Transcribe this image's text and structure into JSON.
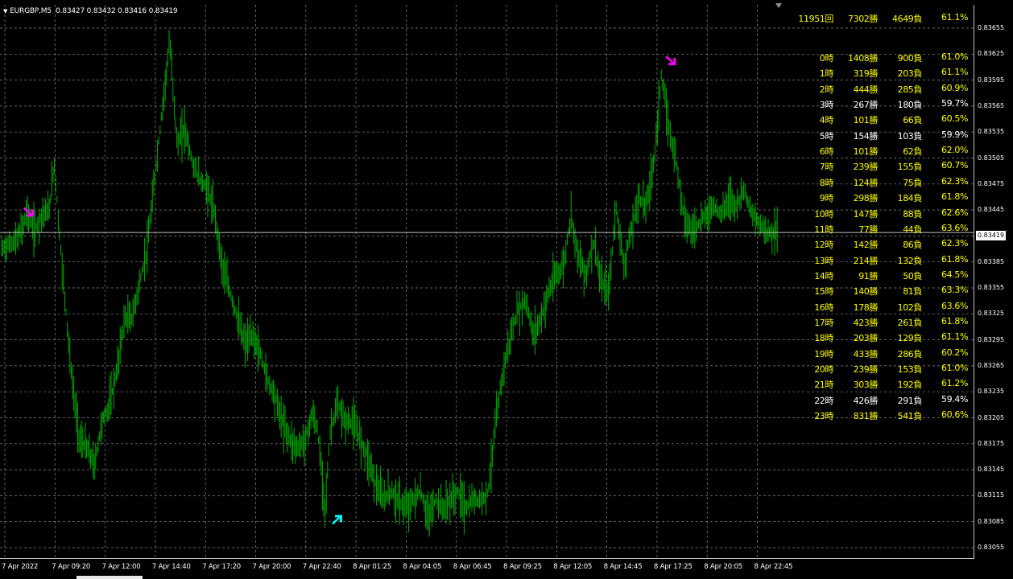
{
  "window": {
    "symbol": "EURGBP,M5",
    "ohlc": "0.83427 0.83432 0.83416 0.83419",
    "current_price": "0.83419"
  },
  "colors": {
    "background": "#000000",
    "candles": "#00b000",
    "grid": "#8a8a8a",
    "price_line": "#c0c0c0",
    "sell_arrow": "#ff00ff",
    "buy_arrow": "#00ffff",
    "stats_highlight": "#ffff00",
    "stats_normal": "#ffffff"
  },
  "y_axis": [
    "0.83655",
    "0.83625",
    "0.83595",
    "0.83565",
    "0.83535",
    "0.83505",
    "0.83475",
    "0.83445",
    "0.83415",
    "0.83385",
    "0.83355",
    "0.83325",
    "0.83295",
    "0.83265",
    "0.83235",
    "0.83205",
    "0.83175",
    "0.83145",
    "0.83115",
    "0.83085",
    "0.83055"
  ],
  "x_axis": [
    "7 Apr 2022",
    "7 Apr 09:20",
    "7 Apr 12:00",
    "7 Apr 14:40",
    "7 Apr 17:20",
    "7 Apr 20:00",
    "7 Apr 22:40",
    "8 Apr 01:25",
    "8 Apr 04:05",
    "8 Apr 06:45",
    "8 Apr 09:25",
    "8 Apr 12:05",
    "8 Apr 14:45",
    "8 Apr 17:25",
    "8 Apr 20:05",
    "8 Apr 22:45"
  ],
  "summary": {
    "total": "11951回",
    "wins": "7302勝",
    "losses": "4649負",
    "rate": "61.1%",
    "highlight": true
  },
  "hourly_stats": [
    {
      "hour": "0時",
      "wins": "1408勝",
      "losses": "900負",
      "rate": "61.0%",
      "highlight": true
    },
    {
      "hour": "1時",
      "wins": "319勝",
      "losses": "203負",
      "rate": "61.1%",
      "highlight": true
    },
    {
      "hour": "2時",
      "wins": "444勝",
      "losses": "285負",
      "rate": "60.9%",
      "highlight": true
    },
    {
      "hour": "3時",
      "wins": "267勝",
      "losses": "180負",
      "rate": "59.7%",
      "highlight": false
    },
    {
      "hour": "4時",
      "wins": "101勝",
      "losses": "66負",
      "rate": "60.5%",
      "highlight": true
    },
    {
      "hour": "5時",
      "wins": "154勝",
      "losses": "103負",
      "rate": "59.9%",
      "highlight": false
    },
    {
      "hour": "6時",
      "wins": "101勝",
      "losses": "62負",
      "rate": "62.0%",
      "highlight": true
    },
    {
      "hour": "7時",
      "wins": "239勝",
      "losses": "155負",
      "rate": "60.7%",
      "highlight": true
    },
    {
      "hour": "8時",
      "wins": "124勝",
      "losses": "75負",
      "rate": "62.3%",
      "highlight": true
    },
    {
      "hour": "9時",
      "wins": "298勝",
      "losses": "184負",
      "rate": "61.8%",
      "highlight": true
    },
    {
      "hour": "10時",
      "wins": "147勝",
      "losses": "88負",
      "rate": "62.6%",
      "highlight": true
    },
    {
      "hour": "11時",
      "wins": "77勝",
      "losses": "44負",
      "rate": "63.6%",
      "highlight": true
    },
    {
      "hour": "12時",
      "wins": "142勝",
      "losses": "86負",
      "rate": "62.3%",
      "highlight": true
    },
    {
      "hour": "13時",
      "wins": "214勝",
      "losses": "132負",
      "rate": "61.8%",
      "highlight": true
    },
    {
      "hour": "14時",
      "wins": "91勝",
      "losses": "50負",
      "rate": "64.5%",
      "highlight": true
    },
    {
      "hour": "15時",
      "wins": "140勝",
      "losses": "81負",
      "rate": "63.3%",
      "highlight": true
    },
    {
      "hour": "16時",
      "wins": "178勝",
      "losses": "102負",
      "rate": "63.6%",
      "highlight": true
    },
    {
      "hour": "17時",
      "wins": "423勝",
      "losses": "261負",
      "rate": "61.8%",
      "highlight": true
    },
    {
      "hour": "18時",
      "wins": "203勝",
      "losses": "129負",
      "rate": "61.1%",
      "highlight": true
    },
    {
      "hour": "19時",
      "wins": "433勝",
      "losses": "286負",
      "rate": "60.2%",
      "highlight": true
    },
    {
      "hour": "20時",
      "wins": "239勝",
      "losses": "153負",
      "rate": "61.0%",
      "highlight": true
    },
    {
      "hour": "21時",
      "wins": "303勝",
      "losses": "192負",
      "rate": "61.2%",
      "highlight": true
    },
    {
      "hour": "22時",
      "wins": "426勝",
      "losses": "291負",
      "rate": "59.4%",
      "highlight": false
    },
    {
      "hour": "23時",
      "wins": "831勝",
      "losses": "541負",
      "rate": "60.6%",
      "highlight": true
    }
  ],
  "chart_data": {
    "type": "line",
    "xlabel": "",
    "ylabel": "",
    "x": [
      "7 Apr 2022",
      "7 Apr 09:20",
      "7 Apr 12:00",
      "7 Apr 14:40",
      "7 Apr 17:20",
      "7 Apr 20:00",
      "7 Apr 22:40",
      "8 Apr 01:25",
      "8 Apr 04:05",
      "8 Apr 06:45",
      "8 Apr 09:25",
      "8 Apr 12:05",
      "8 Apr 14:45",
      "8 Apr 17:25",
      "8 Apr 20:05",
      "8 Apr 22:45"
    ],
    "ylim": [
      0.8305,
      0.8367
    ],
    "current_price": 0.83419,
    "price_path": [
      [
        0,
        0.834
      ],
      [
        0.3,
        0.8341
      ],
      [
        0.45,
        0.8343
      ],
      [
        0.5,
        0.83445
      ],
      [
        0.65,
        0.8342
      ],
      [
        0.8,
        0.8344
      ],
      [
        0.95,
        0.83445
      ],
      [
        1.05,
        0.835
      ],
      [
        1.15,
        0.8342
      ],
      [
        1.25,
        0.8335
      ],
      [
        1.4,
        0.8325
      ],
      [
        1.55,
        0.8318
      ],
      [
        1.7,
        0.8317
      ],
      [
        1.85,
        0.8315
      ],
      [
        2.0,
        0.832
      ],
      [
        2.15,
        0.8322
      ],
      [
        2.3,
        0.8326
      ],
      [
        2.45,
        0.8332
      ],
      [
        2.6,
        0.8332
      ],
      [
        2.75,
        0.8336
      ],
      [
        2.9,
        0.834
      ],
      [
        3.05,
        0.8348
      ],
      [
        3.2,
        0.8356
      ],
      [
        3.35,
        0.8364
      ],
      [
        3.5,
        0.8352
      ],
      [
        3.65,
        0.8354
      ],
      [
        3.8,
        0.835
      ],
      [
        3.95,
        0.8348
      ],
      [
        4.1,
        0.8347
      ],
      [
        4.25,
        0.8344
      ],
      [
        4.4,
        0.8338
      ],
      [
        4.55,
        0.8335
      ],
      [
        4.7,
        0.8332
      ],
      [
        4.85,
        0.8329
      ],
      [
        5.0,
        0.833
      ],
      [
        5.15,
        0.8328
      ],
      [
        5.3,
        0.8325
      ],
      [
        5.45,
        0.8323
      ],
      [
        5.6,
        0.832
      ],
      [
        5.75,
        0.8318
      ],
      [
        5.9,
        0.8317
      ],
      [
        6.05,
        0.8318
      ],
      [
        6.2,
        0.8321
      ],
      [
        6.3,
        0.8319
      ],
      [
        6.45,
        0.831
      ],
      [
        6.55,
        0.8319
      ],
      [
        6.7,
        0.8322
      ],
      [
        6.85,
        0.832
      ],
      [
        7.0,
        0.832
      ],
      [
        7.15,
        0.8318
      ],
      [
        7.3,
        0.8316
      ],
      [
        7.45,
        0.8313
      ],
      [
        7.6,
        0.8311
      ],
      [
        7.75,
        0.8312
      ],
      [
        7.9,
        0.8311
      ],
      [
        8.05,
        0.831
      ],
      [
        8.2,
        0.8311
      ],
      [
        8.35,
        0.8312
      ],
      [
        8.5,
        0.8309
      ],
      [
        8.65,
        0.8311
      ],
      [
        8.8,
        0.831
      ],
      [
        8.95,
        0.8311
      ],
      [
        9.1,
        0.8312
      ],
      [
        9.25,
        0.831
      ],
      [
        9.4,
        0.8311
      ],
      [
        9.55,
        0.8311
      ],
      [
        9.7,
        0.8312
      ],
      [
        9.85,
        0.832
      ],
      [
        10.0,
        0.8326
      ],
      [
        10.15,
        0.833
      ],
      [
        10.3,
        0.8333
      ],
      [
        10.45,
        0.8334
      ],
      [
        10.6,
        0.833
      ],
      [
        10.75,
        0.8332
      ],
      [
        10.9,
        0.8335
      ],
      [
        11.05,
        0.8337
      ],
      [
        11.2,
        0.8338
      ],
      [
        11.35,
        0.8344
      ],
      [
        11.5,
        0.8339
      ],
      [
        11.65,
        0.8337
      ],
      [
        11.8,
        0.8341
      ],
      [
        11.95,
        0.8336
      ],
      [
        12.1,
        0.8335
      ],
      [
        12.25,
        0.8345
      ],
      [
        12.4,
        0.8338
      ],
      [
        12.55,
        0.8342
      ],
      [
        12.7,
        0.8346
      ],
      [
        12.85,
        0.8345
      ],
      [
        13.0,
        0.835
      ],
      [
        13.15,
        0.836
      ],
      [
        13.3,
        0.8354
      ],
      [
        13.45,
        0.835
      ],
      [
        13.6,
        0.8344
      ],
      [
        13.75,
        0.8342
      ],
      [
        13.9,
        0.8343
      ],
      [
        14.05,
        0.8344
      ],
      [
        14.2,
        0.8345
      ],
      [
        14.35,
        0.8344
      ],
      [
        14.5,
        0.8346
      ],
      [
        14.65,
        0.8345
      ],
      [
        14.8,
        0.8347
      ],
      [
        14.95,
        0.8344
      ],
      [
        15.1,
        0.8343
      ],
      [
        15.25,
        0.8342
      ],
      [
        15.4,
        0.8342
      ]
    ],
    "signals": [
      {
        "type": "sell",
        "x": 0.35,
        "y": 0.8344
      },
      {
        "type": "buy",
        "x": 6.5,
        "y": 0.8309
      },
      {
        "type": "sell",
        "x": 13.15,
        "y": 0.83615
      }
    ]
  }
}
